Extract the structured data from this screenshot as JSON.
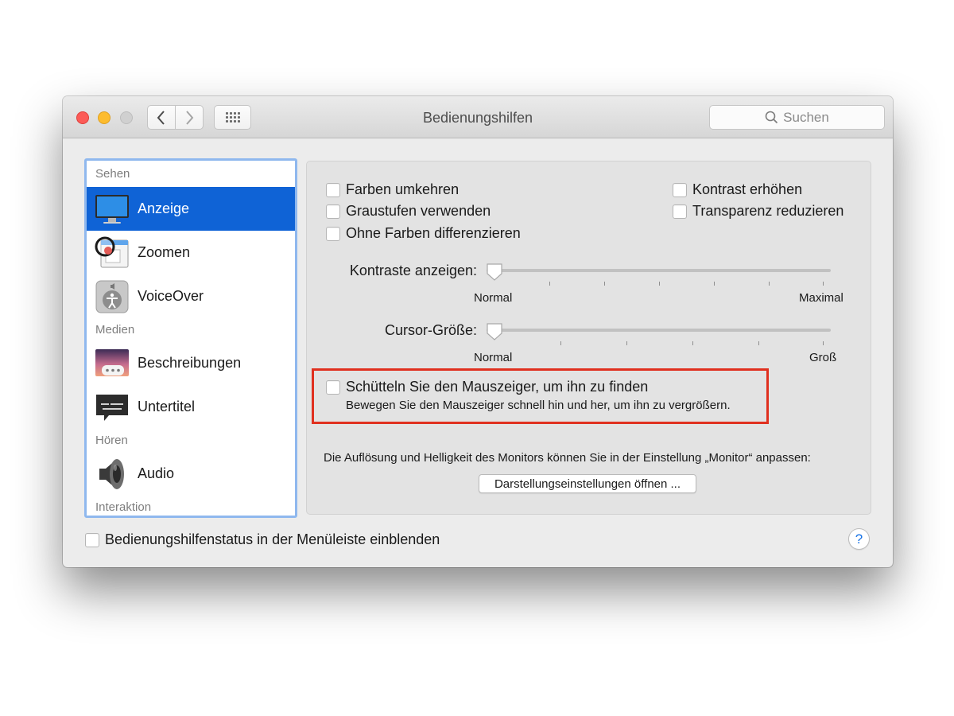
{
  "window": {
    "title": "Bedienungshilfen"
  },
  "toolbar": {
    "search_placeholder": "Suchen"
  },
  "sidebar": {
    "sections": [
      "Sehen",
      "Medien",
      "Hören",
      "Interaktion"
    ],
    "items": [
      {
        "label": "Anzeige",
        "icon": "display-icon",
        "selected": true
      },
      {
        "label": "Zoomen",
        "icon": "zoom-icon",
        "selected": false
      },
      {
        "label": "VoiceOver",
        "icon": "voiceover-icon",
        "selected": false
      },
      {
        "label": "Beschreibungen",
        "icon": "descriptions-icon",
        "selected": false
      },
      {
        "label": "Untertitel",
        "icon": "captions-icon",
        "selected": false
      },
      {
        "label": "Audio",
        "icon": "speaker-icon",
        "selected": false
      }
    ]
  },
  "display_options": {
    "invert_colors": "Farben umkehren",
    "grayscale": "Graustufen verwenden",
    "differentiate_without_color": "Ohne Farben differenzieren",
    "increase_contrast": "Kontrast erhöhen",
    "reduce_transparency": "Transparenz reduzieren"
  },
  "sliders": {
    "contrast": {
      "label": "Kontraste anzeigen:",
      "min_label": "Normal",
      "max_label": "Maximal",
      "value": 0
    },
    "cursor": {
      "label": "Cursor-Größe:",
      "min_label": "Normal",
      "max_label": "Groß",
      "value": 0
    }
  },
  "shake": {
    "label": "Schütteln Sie den Mauszeiger, um ihn zu finden",
    "description": "Bewegen Sie den Mauszeiger schnell hin und her, um ihn zu vergrößern."
  },
  "monitor": {
    "hint": "Die Auflösung und Helligkeit des Monitors können Sie in der Einstellung „Monitor“ anpassen:",
    "button_label": "Darstellungseinstellungen öffnen ..."
  },
  "footer": {
    "menu_status_label": "Bedienungshilfenstatus in der Menüleiste einblenden",
    "help_label": "?"
  },
  "colors": {
    "selection": "#0f63d6",
    "sidebar_focus_ring": "#8fb8ee",
    "highlight_border": "#e0301f",
    "close": "#fc5b57",
    "minimize": "#fdbc2e"
  }
}
